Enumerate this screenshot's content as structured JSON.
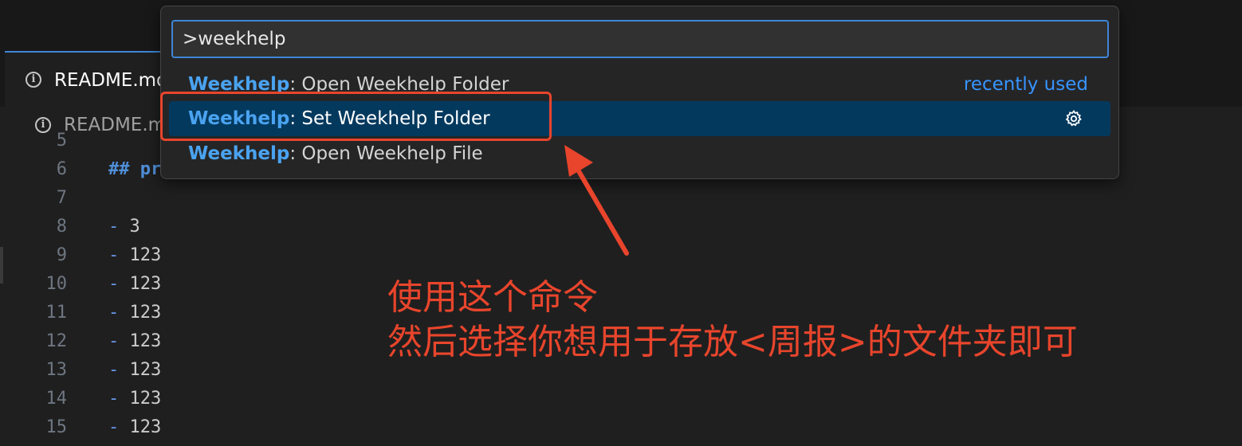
{
  "tabs": {
    "active_label": "README.md",
    "breadcrumb_label": "README.md"
  },
  "editor": {
    "lines": [
      {
        "num": "5",
        "dash": "",
        "text": ""
      },
      {
        "num": "6",
        "dash": "",
        "text": "## pr"
      },
      {
        "num": "7",
        "dash": "",
        "text": ""
      },
      {
        "num": "8",
        "dash": "-",
        "text": " 3"
      },
      {
        "num": "9",
        "dash": "-",
        "text": " 123"
      },
      {
        "num": "10",
        "dash": "-",
        "text": " 123"
      },
      {
        "num": "11",
        "dash": "-",
        "text": " 123"
      },
      {
        "num": "12",
        "dash": "-",
        "text": " 123"
      },
      {
        "num": "13",
        "dash": "-",
        "text": " 123"
      },
      {
        "num": "14",
        "dash": "-",
        "text": " 123"
      },
      {
        "num": "15",
        "dash": "-",
        "text": " 123"
      }
    ]
  },
  "palette": {
    "input_value": ">weekhelp",
    "items": [
      {
        "category": "Weekhelp",
        "label": ": Open Weekhelp Folder",
        "hint": "recently used",
        "selected": false
      },
      {
        "category": "Weekhelp",
        "label": ": Set Weekhelp Folder",
        "hint": "",
        "selected": true,
        "icon": "gear-icon"
      },
      {
        "category": "Weekhelp",
        "label": ": Open Weekhelp File",
        "hint": "",
        "selected": false
      }
    ]
  },
  "annotation": {
    "line1": "使用这个命令",
    "line2": "然后选择你想用于存放<周报>的文件夹即可",
    "color": "#e8452c"
  },
  "colors": {
    "accent": "#3e86d6",
    "selected_bg": "#04395e",
    "category": "#4aa3f0"
  }
}
